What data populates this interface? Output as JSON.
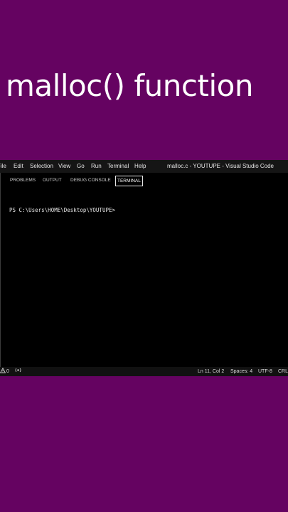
{
  "video_title": "malloc() function",
  "menubar": {
    "items": [
      "File",
      "Edit",
      "Selection",
      "View",
      "Go",
      "Run",
      "Terminal",
      "Help"
    ],
    "window_title": "malloc.c - YOUTUPE - Visual Studio Code"
  },
  "panel": {
    "tabs": [
      "PROBLEMS",
      "OUTPUT",
      "DEBUG CONSOLE",
      "TERMINAL"
    ],
    "active_tab": "TERMINAL",
    "terminal_prompt": "PS C:\\Users\\HOME\\Desktop\\YOUTUPE>"
  },
  "statusbar": {
    "warnings_count": "0",
    "position": "Ln 11, Col 2",
    "spaces": "Spaces: 4",
    "encoding": "UTF-8",
    "line_ending": "CRL"
  },
  "colors": {
    "background": "#650361",
    "editor": "#000000"
  }
}
